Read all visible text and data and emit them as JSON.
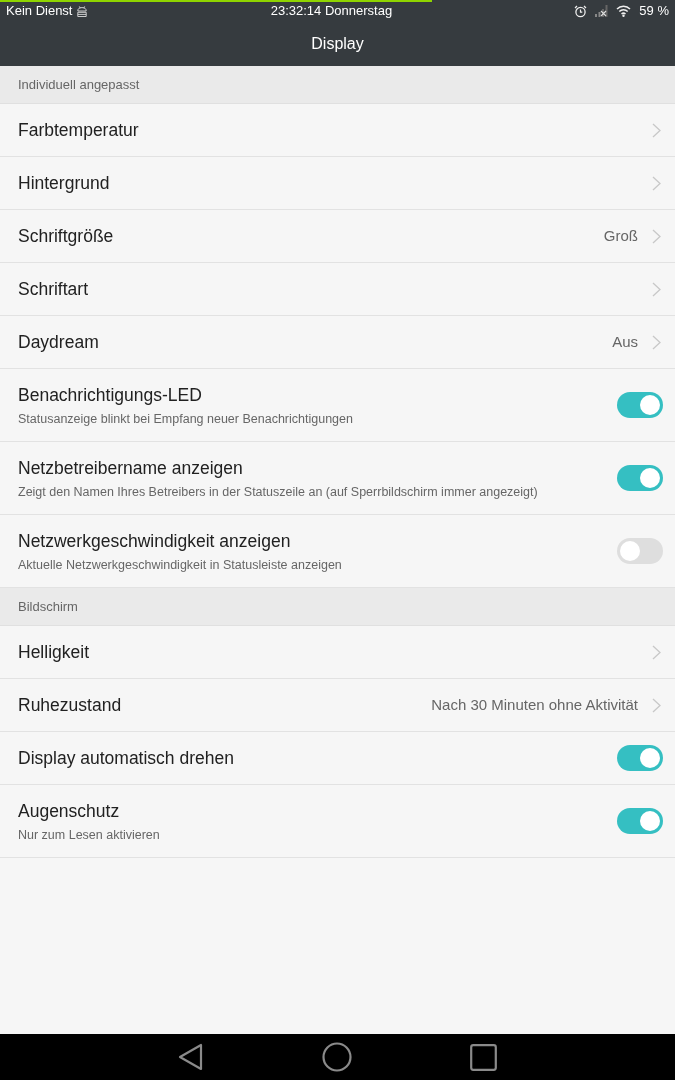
{
  "status_bar": {
    "progress": {
      "level": 0.64
    },
    "carrier": "Kein Dienst",
    "clock": "23:32:14 Donnerstag",
    "battery": "59 %"
  },
  "title": "Display",
  "sections": [
    {
      "header": "Individuell angepasst",
      "items": [
        {
          "kind": "link",
          "title": "Farbtemperatur"
        },
        {
          "kind": "link",
          "title": "Hintergrund"
        },
        {
          "kind": "link",
          "title": "Schriftgröße",
          "value": "Groß"
        },
        {
          "kind": "link",
          "title": "Schriftart"
        },
        {
          "kind": "link",
          "title": "Daydream",
          "value": "Aus"
        },
        {
          "kind": "switch",
          "title": "Benachrichtigungs-LED",
          "subtitle": "Statusanzeige blinkt bei Empfang neuer Benachrichtigungen",
          "on": true
        },
        {
          "kind": "switch",
          "title": "Netzbetreibername anzeigen",
          "subtitle": "Zeigt den Namen Ihres Betreibers in der Statuszeile an (auf Sperrbildschirm immer angezeigt)",
          "on": true
        },
        {
          "kind": "switch",
          "title": "Netzwerkgeschwindigkeit anzeigen",
          "subtitle": "Aktuelle Netzwerkgeschwindigkeit in Statusleiste anzeigen",
          "on": false
        }
      ]
    },
    {
      "header": "Bildschirm",
      "items": [
        {
          "kind": "link",
          "title": "Helligkeit"
        },
        {
          "kind": "link",
          "title": "Ruhezustand",
          "value": "Nach 30 Minuten ohne Aktivität"
        },
        {
          "kind": "switch",
          "title": "Display automatisch drehen",
          "on": true
        },
        {
          "kind": "switch",
          "title": "Augenschutz",
          "subtitle": "Nur zum Lesen aktivieren",
          "on": true
        }
      ]
    }
  ]
}
